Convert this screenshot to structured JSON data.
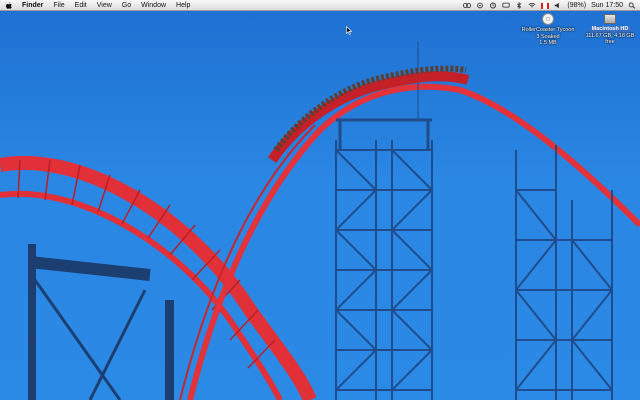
{
  "menubar": {
    "app_name": "Finder",
    "menus": [
      "File",
      "Edit",
      "View",
      "Go",
      "Window",
      "Help"
    ],
    "battery": "(98%)",
    "clock": "Sun 17:50"
  },
  "desktop_icons": [
    {
      "icon": "disk-image-icon",
      "title": "RollerCoaster Tycoon",
      "subtitle": "3 Soaked",
      "size": "1.5 MB"
    },
    {
      "icon": "hard-drive-icon",
      "title": "Macintosh HD",
      "subtitle": "111.67 GB, 4.18 GB free"
    }
  ],
  "colors": {
    "sky": "#2b8ae6",
    "track_red": "#e8333a",
    "support_blue": "#1c3f72"
  }
}
